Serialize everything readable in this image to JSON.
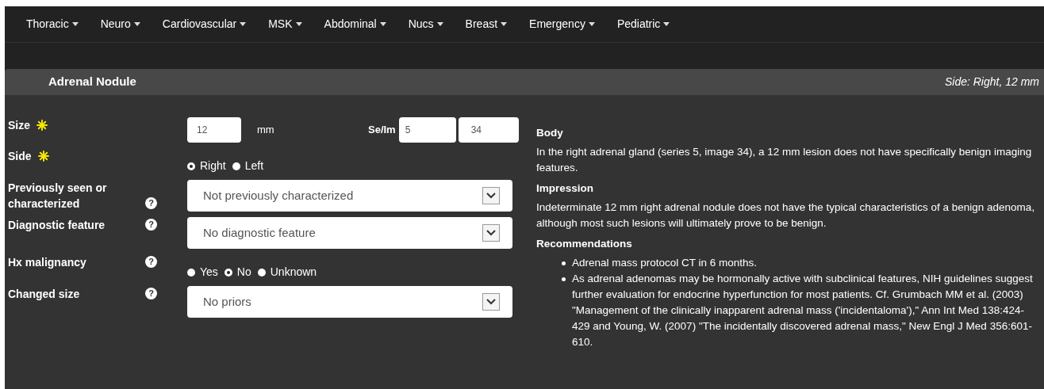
{
  "nav": [
    {
      "label": "Thoracic"
    },
    {
      "label": "Neuro"
    },
    {
      "label": "Cardiovascular"
    },
    {
      "label": "MSK"
    },
    {
      "label": "Abdominal"
    },
    {
      "label": "Nucs"
    },
    {
      "label": "Breast"
    },
    {
      "label": "Emergency"
    },
    {
      "label": "Pediatric"
    }
  ],
  "panel": {
    "title": "Adrenal Nodule",
    "summary": "Side: Right, 12 mm"
  },
  "fields": [
    {
      "kind": "size",
      "label": "Size",
      "required": true,
      "value": "12",
      "unit": "mm",
      "se_im_label": "Se/Im",
      "series": "5",
      "image": "34"
    },
    {
      "kind": "radio",
      "label": "Side",
      "required": true,
      "options": [
        {
          "label": "Right",
          "selected": true
        },
        {
          "label": "Left",
          "selected": false
        }
      ]
    },
    {
      "kind": "select",
      "label": "Previously seen or characterized",
      "help": "?",
      "value": "Not previously characterized"
    },
    {
      "kind": "select",
      "label": "Diagnostic feature",
      "help": "?",
      "value": "No diagnostic feature"
    },
    {
      "kind": "radio",
      "label": "Hx malignancy",
      "help": "?",
      "options": [
        {
          "label": "Yes",
          "selected": false
        },
        {
          "label": "No",
          "selected": true
        },
        {
          "label": "Unknown",
          "selected": false
        }
      ]
    },
    {
      "kind": "select",
      "label": "Changed size",
      "help": "?",
      "value": "No priors"
    }
  ],
  "report": [
    {
      "heading": "Body",
      "kind": "paragraph",
      "text": "In the right adrenal gland (series 5, image 34), a 12 mm lesion does not have specifically benign imaging features."
    },
    {
      "heading": "Impression",
      "kind": "paragraph",
      "text": "Indeterminate 12 mm right adrenal nodule does not have the typical characteristics of a benign adenoma, although most such lesions will ultimately prove to be benign."
    },
    {
      "heading": "Recommendations",
      "kind": "list",
      "items": [
        "Adrenal mass protocol CT in 6 months.",
        "As adrenal adenomas may be hormonally active with subclinical features, NIH guidelines suggest further evaluation for endocrine hyperfunction for most patients. Cf. Grumbach MM et al. (2003) \"Management of the clinically inapparent adrenal mass ('incidentaloma'),\" Ann Int Med 138:424-429 and Young, W. (2007) \"The incidentally discovered adrenal mass,\" New Engl J Med 356:601-610."
      ]
    }
  ]
}
